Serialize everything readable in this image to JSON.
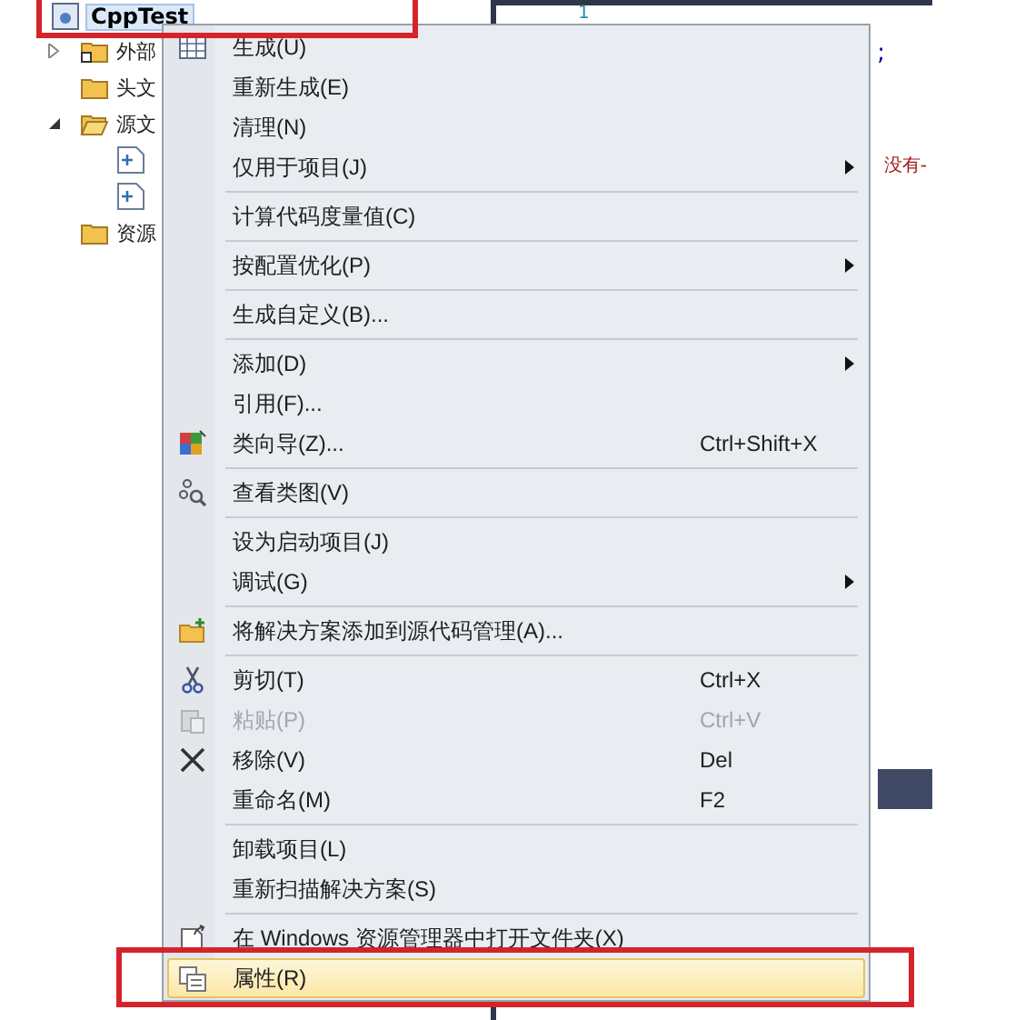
{
  "tree": {
    "root": {
      "label": "CppTest",
      "selected": true
    },
    "items": [
      {
        "label": "外部",
        "kind": "ext",
        "expanded": false
      },
      {
        "label": "头文",
        "kind": "folder"
      },
      {
        "label": "源文",
        "kind": "open",
        "expanded": true
      },
      {
        "kind": "cpp"
      },
      {
        "kind": "cpp"
      },
      {
        "label": "资源",
        "kind": "folder"
      }
    ]
  },
  "editor": {
    "line_number": "1",
    "lines": [
      {
        "text": ";",
        "kind": "code"
      },
      {
        "text": "没有-",
        "kind": "comment"
      }
    ]
  },
  "menu": {
    "groups": [
      {
        "items": [
          {
            "label": "生成(U)",
            "submenu": false,
            "disabled": false,
            "selected": false
          },
          {
            "label": "重新生成(E)",
            "submenu": false,
            "disabled": false,
            "selected": false
          },
          {
            "label": "清理(N)",
            "submenu": false,
            "disabled": false,
            "selected": false
          },
          {
            "label": "仅用于项目(J)",
            "submenu": true,
            "disabled": false,
            "selected": false
          }
        ]
      },
      {
        "items": [
          {
            "label": "计算代码度量值(C)",
            "submenu": false,
            "disabled": false,
            "selected": false
          }
        ]
      },
      {
        "items": [
          {
            "label": "按配置优化(P)",
            "submenu": true,
            "disabled": false,
            "selected": false
          }
        ]
      },
      {
        "items": [
          {
            "label": "生成自定义(B)...",
            "submenu": false,
            "disabled": false,
            "selected": false
          }
        ]
      },
      {
        "items": [
          {
            "label": "添加(D)",
            "submenu": true,
            "disabled": false,
            "selected": false
          },
          {
            "label": "引用(F)...",
            "submenu": false,
            "disabled": false,
            "selected": false
          },
          {
            "label": "类向导(Z)...",
            "shortcut": "Ctrl+Shift+X",
            "submenu": false,
            "disabled": false,
            "selected": false
          }
        ]
      },
      {
        "items": [
          {
            "label": "查看类图(V)",
            "submenu": false,
            "disabled": false,
            "selected": false
          }
        ]
      },
      {
        "items": [
          {
            "label": "设为启动项目(J)",
            "submenu": false,
            "disabled": false,
            "selected": false
          },
          {
            "label": "调试(G)",
            "submenu": true,
            "disabled": false,
            "selected": false
          }
        ]
      },
      {
        "items": [
          {
            "label": "将解决方案添加到源代码管理(A)...",
            "submenu": false,
            "disabled": false,
            "selected": false
          }
        ]
      },
      {
        "items": [
          {
            "label": "剪切(T)",
            "shortcut": "Ctrl+X",
            "submenu": false,
            "disabled": false,
            "selected": false
          },
          {
            "label": "粘贴(P)",
            "shortcut": "Ctrl+V",
            "submenu": false,
            "disabled": true,
            "selected": false
          },
          {
            "label": "移除(V)",
            "shortcut": "Del",
            "submenu": false,
            "disabled": false,
            "selected": false
          },
          {
            "label": "重命名(M)",
            "shortcut": "F2",
            "submenu": false,
            "disabled": false,
            "selected": false
          }
        ]
      },
      {
        "items": [
          {
            "label": "卸载项目(L)",
            "submenu": false,
            "disabled": false,
            "selected": false
          },
          {
            "label": "重新扫描解决方案(S)",
            "submenu": false,
            "disabled": false,
            "selected": false
          }
        ]
      },
      {
        "items": [
          {
            "label": "在 Windows 资源管理器中打开文件夹(X)",
            "submenu": false,
            "disabled": false,
            "selected": false
          },
          {
            "label": "属性(R)",
            "submenu": false,
            "disabled": false,
            "selected": true
          }
        ]
      }
    ]
  }
}
